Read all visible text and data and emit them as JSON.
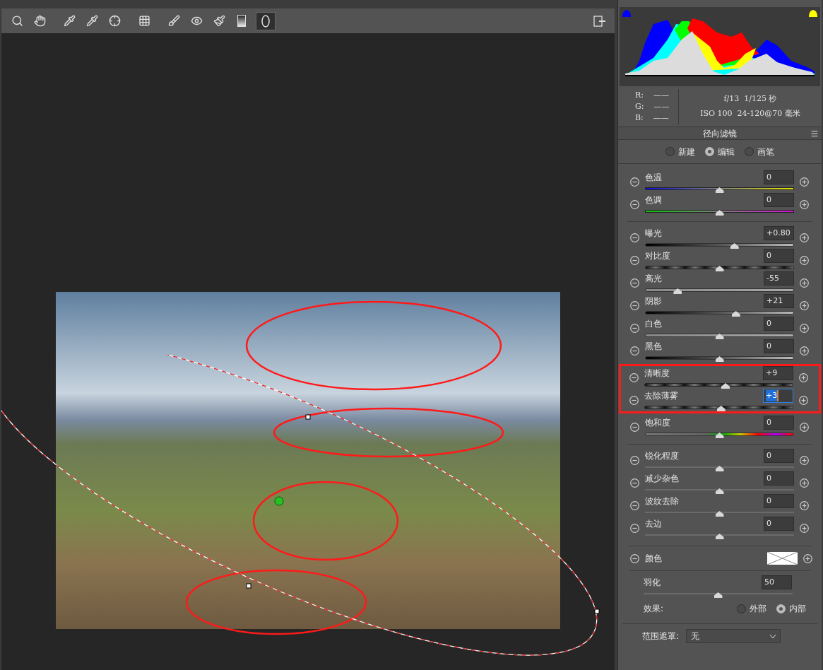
{
  "toolbar": {
    "tools": [
      {
        "kind": "zoom",
        "selected": false
      },
      {
        "kind": "hand",
        "selected": false
      },
      {
        "kind": "white-balance",
        "selected": false
      },
      {
        "kind": "color-sampler",
        "selected": false
      },
      {
        "kind": "target",
        "selected": false
      },
      {
        "kind": "transform",
        "selected": false
      },
      {
        "kind": "spot-removal",
        "selected": false
      },
      {
        "kind": "red-eye",
        "selected": false
      },
      {
        "kind": "brush",
        "selected": false
      },
      {
        "kind": "graduated",
        "selected": false
      },
      {
        "kind": "radial",
        "selected": true
      }
    ]
  },
  "info": {
    "rgb": [
      {
        "label": "R:",
        "value": "——"
      },
      {
        "label": "G:",
        "value": "——"
      },
      {
        "label": "B:",
        "value": "——"
      }
    ],
    "camera": [
      "f/13  1/125 秒",
      "ISO 100  24-120@70 毫米"
    ]
  },
  "panel": {
    "title": "径向滤镜",
    "modes": [
      {
        "label": "新建",
        "selected": false
      },
      {
        "label": "编辑",
        "selected": true
      },
      {
        "label": "画笔",
        "selected": false
      }
    ],
    "groups": [
      {
        "highlighted": false,
        "sliders": [
          {
            "label": "色温",
            "value": "0",
            "level": 0.5,
            "kind": "temperature",
            "focused": false
          },
          {
            "label": "色调",
            "value": "0",
            "level": 0.5,
            "kind": "tint",
            "focused": false
          }
        ]
      },
      {
        "highlighted": false,
        "sliders": [
          {
            "label": "曝光",
            "value": "+0.80",
            "level": 0.6,
            "kind": "dark-fade",
            "focused": false
          },
          {
            "label": "对比度",
            "value": "0",
            "level": 0.5,
            "kind": "banded",
            "focused": false
          },
          {
            "label": "高光",
            "value": "-55",
            "level": 0.22,
            "kind": "light",
            "focused": false
          },
          {
            "label": "阴影",
            "value": "+21",
            "level": 0.61,
            "kind": "dark-fade",
            "focused": false
          },
          {
            "label": "白色",
            "value": "0",
            "level": 0.5,
            "kind": "light",
            "focused": false
          },
          {
            "label": "黑色",
            "value": "0",
            "level": 0.5,
            "kind": "dark-fade",
            "focused": false
          }
        ]
      },
      {
        "highlighted": true,
        "sliders": [
          {
            "label": "清晰度",
            "value": "+9",
            "level": 0.545,
            "kind": "banded",
            "focused": false
          },
          {
            "label": "去除薄雾",
            "value": "+3",
            "level": 0.515,
            "kind": "banded",
            "focused": true
          }
        ]
      },
      {
        "highlighted": false,
        "sliders": [
          {
            "label": "饱和度",
            "value": "0",
            "level": 0.5,
            "kind": "rainbow",
            "focused": false
          }
        ]
      },
      {
        "highlighted": false,
        "sliders": [
          {
            "label": "锐化程度",
            "value": "0",
            "level": 0.5,
            "kind": "thin",
            "focused": false
          },
          {
            "label": "减少杂色",
            "value": "0",
            "level": 0.5,
            "kind": "thin",
            "focused": false
          },
          {
            "label": "波纹去除",
            "value": "0",
            "level": 0.5,
            "kind": "thin",
            "focused": false
          },
          {
            "label": "去边",
            "value": "0",
            "level": 0.5,
            "kind": "thin",
            "focused": false
          }
        ]
      }
    ],
    "color": {
      "label": "颜色"
    },
    "feather": {
      "label": "羽化",
      "value": "50",
      "level": 0.5
    },
    "effect": {
      "label": "效果:",
      "options": [
        {
          "label": "外部",
          "selected": false
        },
        {
          "label": "内部",
          "selected": true
        }
      ]
    },
    "range_mask": {
      "label": "范围遮罩:",
      "value": "无"
    }
  }
}
